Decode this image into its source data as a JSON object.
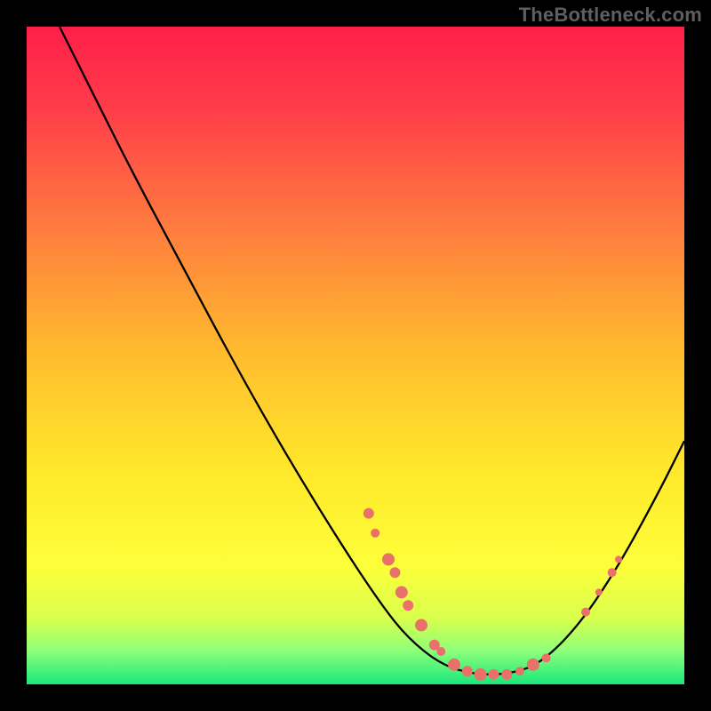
{
  "watermark": "TheBottleneck.com",
  "colors": {
    "marker": "#e9716a",
    "curve": "#000000"
  },
  "chart_data": {
    "type": "line",
    "title": "",
    "xlabel": "",
    "ylabel": "",
    "xlim": [
      0,
      100
    ],
    "ylim": [
      0,
      100
    ],
    "curve_points": [
      {
        "x": 5,
        "y": 100
      },
      {
        "x": 10,
        "y": 90
      },
      {
        "x": 16,
        "y": 78
      },
      {
        "x": 24,
        "y": 63
      },
      {
        "x": 32,
        "y": 48
      },
      {
        "x": 40,
        "y": 34
      },
      {
        "x": 48,
        "y": 21
      },
      {
        "x": 54,
        "y": 12
      },
      {
        "x": 58,
        "y": 7
      },
      {
        "x": 63,
        "y": 3
      },
      {
        "x": 68,
        "y": 1.5
      },
      {
        "x": 73,
        "y": 1.5
      },
      {
        "x": 78,
        "y": 3
      },
      {
        "x": 84,
        "y": 9
      },
      {
        "x": 90,
        "y": 18
      },
      {
        "x": 96,
        "y": 29
      },
      {
        "x": 100,
        "y": 37
      }
    ],
    "markers": [
      {
        "x": 52,
        "y": 26,
        "r": 6
      },
      {
        "x": 53,
        "y": 23,
        "r": 5
      },
      {
        "x": 55,
        "y": 19,
        "r": 7
      },
      {
        "x": 56,
        "y": 17,
        "r": 6
      },
      {
        "x": 57,
        "y": 14,
        "r": 7
      },
      {
        "x": 58,
        "y": 12,
        "r": 6
      },
      {
        "x": 60,
        "y": 9,
        "r": 7
      },
      {
        "x": 62,
        "y": 6,
        "r": 6
      },
      {
        "x": 63,
        "y": 5,
        "r": 5
      },
      {
        "x": 65,
        "y": 3,
        "r": 7
      },
      {
        "x": 67,
        "y": 2,
        "r": 6
      },
      {
        "x": 69,
        "y": 1.5,
        "r": 7
      },
      {
        "x": 71,
        "y": 1.5,
        "r": 6
      },
      {
        "x": 73,
        "y": 1.5,
        "r": 6
      },
      {
        "x": 75,
        "y": 2,
        "r": 5
      },
      {
        "x": 77,
        "y": 3,
        "r": 7
      },
      {
        "x": 79,
        "y": 4,
        "r": 5
      },
      {
        "x": 85,
        "y": 11,
        "r": 5
      },
      {
        "x": 87,
        "y": 14,
        "r": 4
      },
      {
        "x": 89,
        "y": 17,
        "r": 5
      },
      {
        "x": 90,
        "y": 19,
        "r": 4
      }
    ]
  }
}
